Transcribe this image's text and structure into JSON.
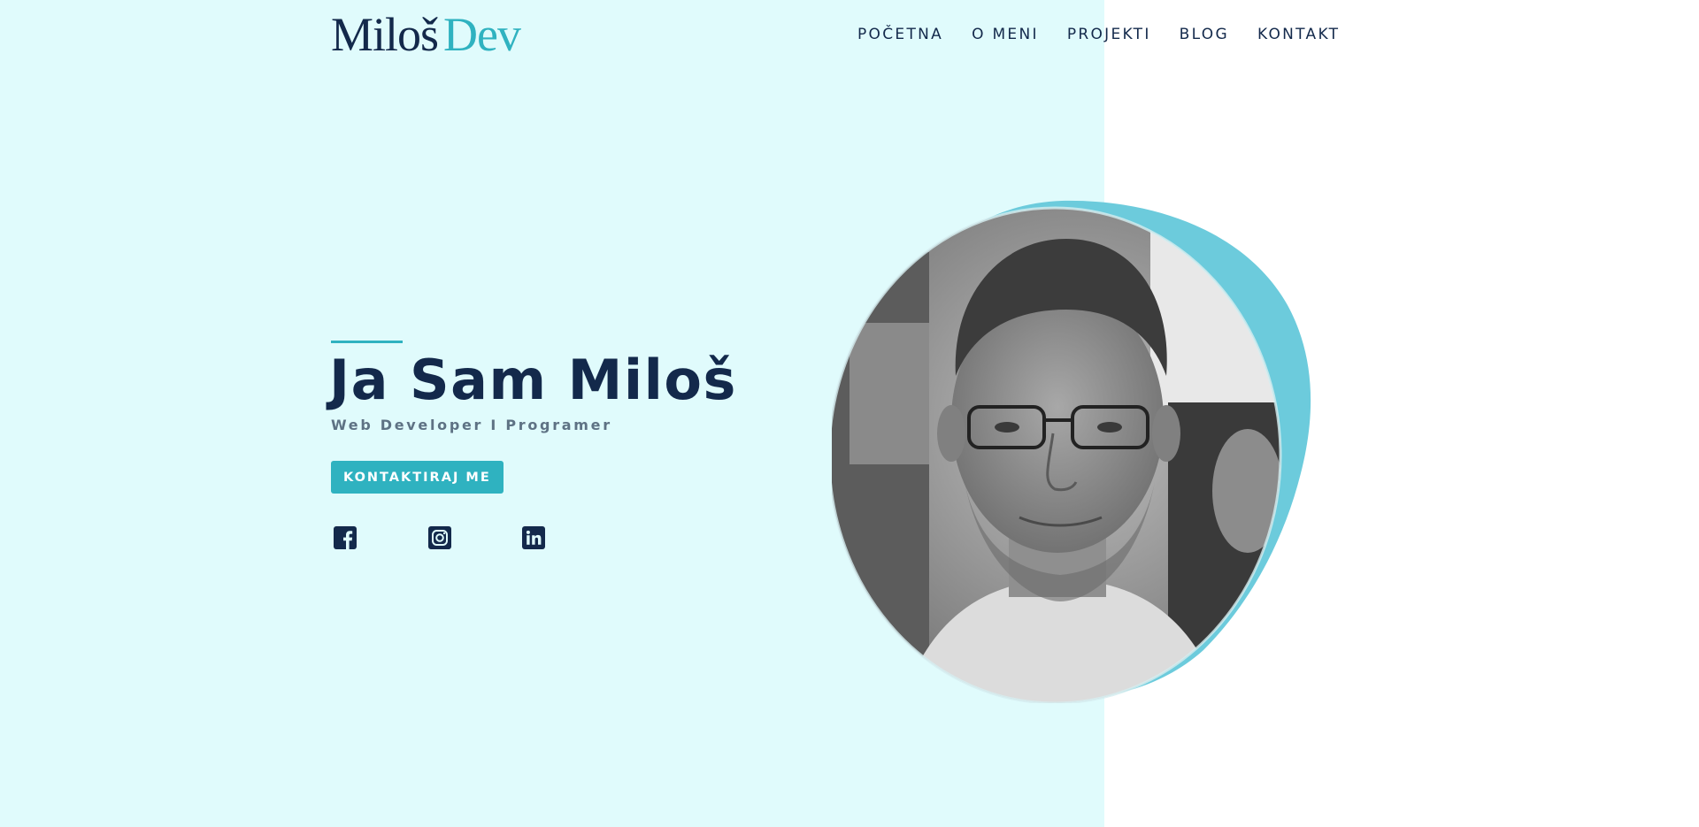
{
  "header": {
    "logo": {
      "part1": "Miloš",
      "part2": "Dev"
    },
    "nav": [
      {
        "label": "POČETNA"
      },
      {
        "label": "O MENI"
      },
      {
        "label": "PROJEKTI"
      },
      {
        "label": "BLOG"
      },
      {
        "label": "KONTAKT"
      }
    ]
  },
  "hero": {
    "title": "Ja Sam Miloš",
    "subtitle": "Web Developer I Programer",
    "cta_label": "KONTAKTIRAJ ME",
    "social": [
      {
        "icon": "facebook-icon"
      },
      {
        "icon": "instagram-icon"
      },
      {
        "icon": "linkedin-icon"
      }
    ],
    "photo": {
      "description_icon": "profile-photo"
    }
  },
  "colors": {
    "navy": "#13294b",
    "accent": "#2fb2c0",
    "blob": "#6ccbdc",
    "left_background": "#e0fbfc",
    "subtitle": "#5e7284"
  }
}
